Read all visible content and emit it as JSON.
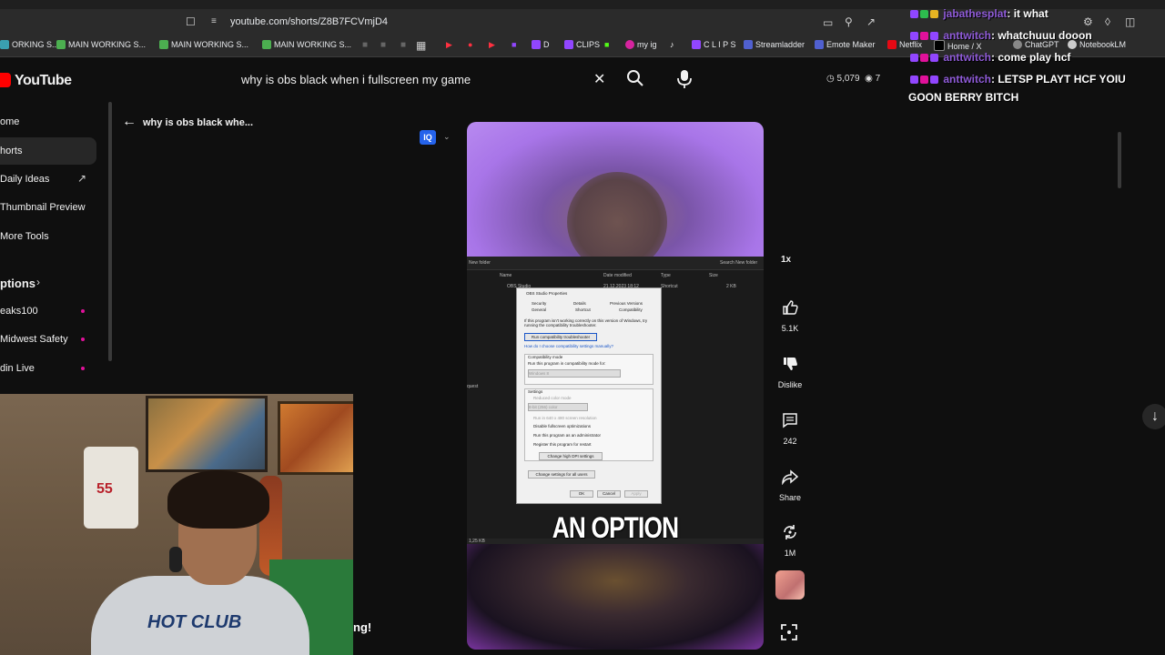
{
  "browser": {
    "url": "youtube.com/shorts/Z8B7FCVmjD4",
    "bookmarks": [
      "ORKING S...",
      "MAIN WORKING S...",
      "MAIN WORKING S...",
      "MAIN WORKING S...",
      "D",
      "CLIPS",
      "my ig",
      "C L I P S",
      "Streamladder",
      "Emote Maker",
      "Netflix",
      "Home / X",
      "ChatGPT",
      "NotebookLM"
    ]
  },
  "header": {
    "logo_text": "YouTube",
    "search_query": "why is obs black when i fullscreen my game",
    "stats_views": "5,079",
    "stats_watchers": "7"
  },
  "sidebar": {
    "items": [
      "ome",
      "horts",
      "Daily Ideas",
      "Thumbnail Preview",
      "More Tools"
    ],
    "section_title": "ptions",
    "subscriptions": [
      "eaks100",
      "Midwest Safety",
      "din Live"
    ]
  },
  "short": {
    "title": "why is obs black whe...",
    "badge": "IQ",
    "caption": "AN OPTION",
    "speed": "1x",
    "likes": "5.1K",
    "dislike_label": "Dislike",
    "comments": "242",
    "share_label": "Share",
    "remix_count": "1M"
  },
  "explorer": {
    "folder": "New folder",
    "search_placeholder": "Search New folder",
    "col_name": "Name",
    "col_date": "Date modified",
    "col_type": "Type",
    "col_size": "Size",
    "file_name": "OBS Studio",
    "file_date": "21.12.2023 18:12",
    "file_type": "Shortcut",
    "file_size": "2 KB",
    "left_label": "quest",
    "status": "1,25 KB"
  },
  "dialog": {
    "title": "OBS Studio Properties",
    "tabs": [
      "Security",
      "Details",
      "Previous Versions",
      "General",
      "Shortcut",
      "Compatibility"
    ],
    "intro": "If this program isn't working correctly on this version of Windows, try running the compatibility troubleshooter.",
    "troubleshoot_btn": "Run compatibility troubleshooter",
    "manual_link": "How do I choose compatibility settings manually?",
    "compat_mode": "Compatibility mode",
    "compat_check": "Run this program in compatibility mode for:",
    "compat_select": "Windows 8",
    "settings": "Settings",
    "opt1": "Reduced color mode",
    "opt1_value": "8-bit (256) color",
    "opt2": "Run in 640 x 480 screen resolution",
    "opt3": "Disable fullscreen optimizations",
    "opt4": "Run this program as an administrator",
    "opt5": "Register this program for restart",
    "dpi_btn": "Change high DPI settings",
    "all_users_btn": "Change settings for all users",
    "ok": "OK",
    "cancel": "Cancel",
    "apply": "Apply"
  },
  "chat": [
    {
      "user": "jabathesplat",
      "message": ": it what"
    },
    {
      "user": "anttwitch",
      "message": ": whatchuuu dooon"
    },
    {
      "user": "anttwitch",
      "message": ": come play hcf"
    },
    {
      "user": "anttwitch",
      "message": ": LETSP PLAYT HCF YOIU"
    },
    {
      "user": "",
      "message": "GOON BERRY BITCH"
    }
  ],
  "webcam": {
    "jersey_number": "55",
    "shirt_text": "HOT CLUB",
    "overlay_text": "ng!"
  },
  "colors": {
    "background": "#0f0f0f",
    "youtube_red": "#ff0000",
    "chat_username": "#8f5bd8",
    "link_blue": "#1a56c8"
  }
}
